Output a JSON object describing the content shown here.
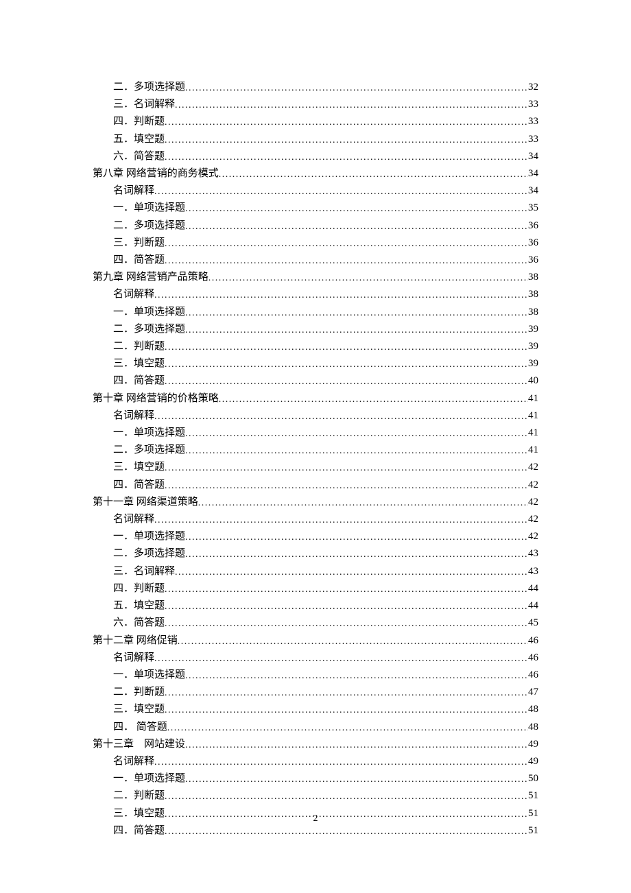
{
  "page_number": "2",
  "toc": [
    {
      "level": 3,
      "title": "二．多项选择题",
      "page": "32"
    },
    {
      "level": 3,
      "title": "三．名词解释",
      "page": "33"
    },
    {
      "level": 3,
      "title": "四．判断题",
      "page": "33"
    },
    {
      "level": 3,
      "title": "五．填空题",
      "page": "33"
    },
    {
      "level": 3,
      "title": "六．简答题",
      "page": "34"
    },
    {
      "level": 1,
      "title": "第八章 网络营销的商务模式",
      "page": "34"
    },
    {
      "level": 2,
      "title": "名词解释",
      "page": "34"
    },
    {
      "level": 3,
      "title": "一．单项选择题",
      "page": "35"
    },
    {
      "level": 3,
      "title": "二．多项选择题",
      "page": "36"
    },
    {
      "level": 3,
      "title": "三．判断题",
      "page": "36"
    },
    {
      "level": 3,
      "title": "四．简答题",
      "page": "36"
    },
    {
      "level": 1,
      "title": "第九章 网络营销产品策略",
      "page": "38"
    },
    {
      "level": 2,
      "title": "名词解释",
      "page": "38"
    },
    {
      "level": 3,
      "title": "一．单项选择题",
      "page": "38"
    },
    {
      "level": 3,
      "title": "二．多项选择题",
      "page": "39"
    },
    {
      "level": 3,
      "title": "二．判断题",
      "page": "39"
    },
    {
      "level": 3,
      "title": "三．填空题",
      "page": "39"
    },
    {
      "level": 3,
      "title": "四．简答题",
      "page": "40"
    },
    {
      "level": 1,
      "title": "第十章 网络营销的价格策略",
      "page": "41"
    },
    {
      "level": 2,
      "title": "名词解释",
      "page": "41"
    },
    {
      "level": 3,
      "title": "一．单项选择题",
      "page": "41"
    },
    {
      "level": 3,
      "title": "二．多项选择题",
      "page": "41"
    },
    {
      "level": 3,
      "title": "三．填空题",
      "page": "42"
    },
    {
      "level": 3,
      "title": "四．简答题",
      "page": "42"
    },
    {
      "level": 1,
      "title": "第十一章  网络渠道策略",
      "page": "42"
    },
    {
      "level": 2,
      "title": "名词解释",
      "page": "42"
    },
    {
      "level": 3,
      "title": "一．单项选择题",
      "page": "42"
    },
    {
      "level": 3,
      "title": "二．多项选择题",
      "page": "43"
    },
    {
      "level": 3,
      "title": "三．名词解释",
      "page": "43"
    },
    {
      "level": 3,
      "title": "四．判断题",
      "page": "44"
    },
    {
      "level": 3,
      "title": "五．填空题",
      "page": "44"
    },
    {
      "level": 3,
      "title": "六．简答题",
      "page": "45"
    },
    {
      "level": 1,
      "title": "第十二章  网络促销",
      "page": "46"
    },
    {
      "level": 2,
      "title": "名词解释",
      "page": "46"
    },
    {
      "level": 3,
      "title": "一．单项选择题",
      "page": "46"
    },
    {
      "level": 3,
      "title": "二．判断题",
      "page": "47"
    },
    {
      "level": 3,
      "title": "三．填空题",
      "page": "48"
    },
    {
      "level": 3,
      "title": "四． 简答题",
      "page": "48"
    },
    {
      "level": 1,
      "title": "第十三章　网站建设",
      "page": "49"
    },
    {
      "level": 2,
      "title": "名词解释",
      "page": "49"
    },
    {
      "level": 3,
      "title": "一．单项选择题",
      "page": "50"
    },
    {
      "level": 3,
      "title": "二．判断题",
      "page": "51"
    },
    {
      "level": 3,
      "title": "三．填空题",
      "page": "51"
    },
    {
      "level": 3,
      "title": "四．简答题",
      "page": "51"
    }
  ]
}
